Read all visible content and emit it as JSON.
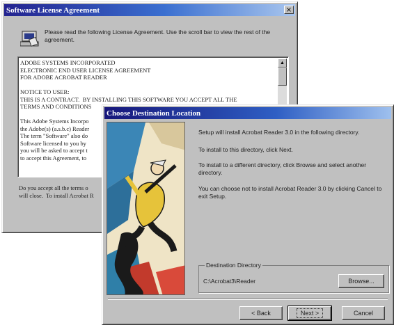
{
  "license_dialog": {
    "title": "Software License Agreement",
    "close_label": "×",
    "instructions": "Please read the following License Agreement.  Use the scroll bar to view the rest of the agreement.",
    "license_text": "ADOBE SYSTEMS INCORPORATED\nELECTRONIC END USER LICENSE AGREEMENT\nFOR ADOBE ACROBAT READER\n\nNOTICE TO USER:\nTHIS IS A CONTRACT.  BY INSTALLING THIS SOFTWARE YOU ACCEPT ALL THE\nTERMS AND CONDITIONS\n\nThis Adobe Systems Incorpo\nthe Adobe(s) (a.s.b.c) Reader\nThe term \"Software\" also do\nSoftware licensed to you by\nyou will be asked to accept t\nto accept this Agreement, to",
    "question": "Do you accept all the terms o\nwill close.  To install Acrobat R"
  },
  "destination_dialog": {
    "title": "Choose Destination Location",
    "para1": "Setup will install Acrobat Reader 3.0 in the following directory.",
    "para2": "To install to this directory, click Next.",
    "para3": "To install to a different directory, click Browse and select another directory.",
    "para4": "You can choose not to install Acrobat Reader 3.0 by clicking Cancel to exit Setup.",
    "group_label": "Destination Directory",
    "directory_path": "C:\\Acrobat3\\Reader",
    "browse_label": "Browse...",
    "back_label": "< Back",
    "next_label": "Next >",
    "cancel_label": "Cancel"
  }
}
